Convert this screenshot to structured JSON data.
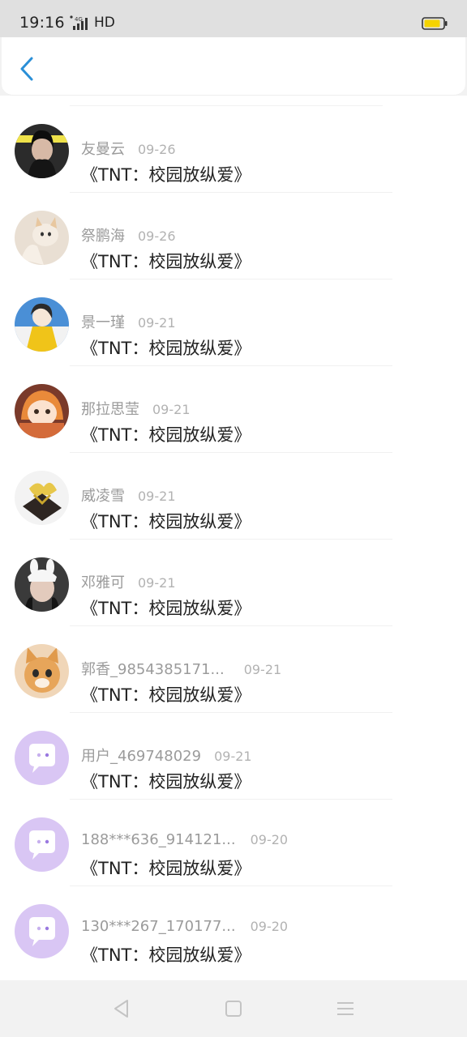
{
  "status_bar": {
    "time": "19:16",
    "network": "HD",
    "icons": [
      "signal-icon",
      "battery-icon"
    ],
    "battery_color": "#f5d400"
  },
  "header": {
    "back_icon": "chevron-left-icon",
    "accent_color": "#2a8fd7"
  },
  "items": [
    {
      "name": "友曼云",
      "date": "09-26",
      "title": "《TNT：校园放纵爱》",
      "avatar": "photo-avatar"
    },
    {
      "name": "祭鹏海",
      "date": "09-26",
      "title": "《TNT：校园放纵爱》",
      "avatar": "cat-photo-avatar"
    },
    {
      "name": "景一瑾",
      "date": "09-21",
      "title": "《TNT：校园放纵爱》",
      "avatar": "cartoon-avatar"
    },
    {
      "name": "那拉思莹",
      "date": "09-21",
      "title": "《TNT：校园放纵爱》",
      "avatar": "anime-avatar"
    },
    {
      "name": "威凌雪",
      "date": "09-21",
      "title": "《TNT：校园放纵爱》",
      "avatar": "object-avatar"
    },
    {
      "name": "邓雅可",
      "date": "09-21",
      "title": "《TNT：校园放纵爱》",
      "avatar": "photo-avatar"
    },
    {
      "name": "郭香_9854385171...",
      "date": "09-21",
      "title": "《TNT：校园放纵爱》",
      "avatar": "kitten-photo-avatar"
    },
    {
      "name": "用户_469748029",
      "date": "09-21",
      "title": "《TNT：校园放纵爱》",
      "avatar": "default-chat-avatar"
    },
    {
      "name": "188***636_914121...",
      "date": "09-20",
      "title": "《TNT：校园放纵爱》",
      "avatar": "default-chat-avatar"
    },
    {
      "name": "130***267_170177...",
      "date": "09-20",
      "title": "《TNT：校园放纵爱》",
      "avatar": "default-chat-avatar"
    }
  ],
  "nav_bar": {
    "icons": [
      "back-triangle-icon",
      "home-square-icon",
      "menu-lines-icon"
    ]
  }
}
